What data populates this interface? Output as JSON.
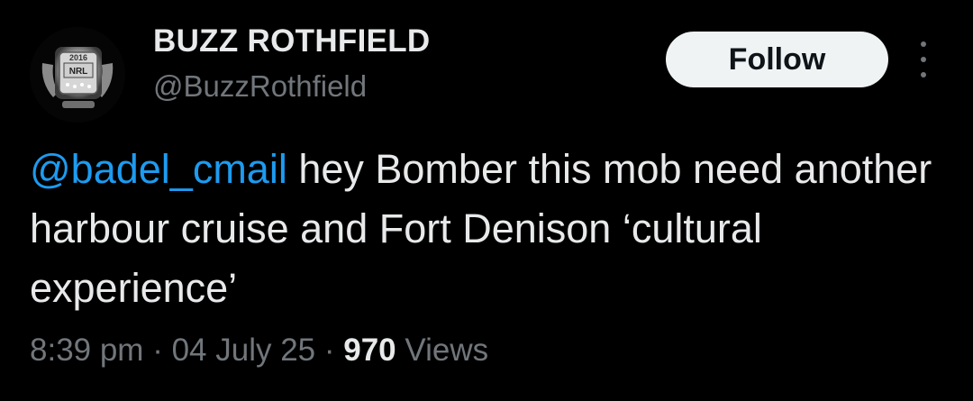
{
  "author": {
    "display_name": "BUZZ ROTHFIELD",
    "handle": "@BuzzRothfield",
    "avatar_badge_top": "2016",
    "avatar_badge_text": "NRL"
  },
  "actions": {
    "follow_label": "Follow",
    "more_icon": "more-vertical-icon"
  },
  "tweet": {
    "mention": "@badel_cmail",
    "text": " hey Bomber this mob need another harbour cruise and Fort Denison ‘cultural experience’"
  },
  "meta": {
    "time": "8:39 pm",
    "separator": " · ",
    "date": "04 July 25",
    "views_count": "970",
    "views_label": " Views"
  },
  "colors": {
    "background": "#000000",
    "text_primary": "#e7e9ea",
    "text_secondary": "#71767b",
    "link": "#1d9bf0",
    "button_bg": "#eff3f4"
  }
}
